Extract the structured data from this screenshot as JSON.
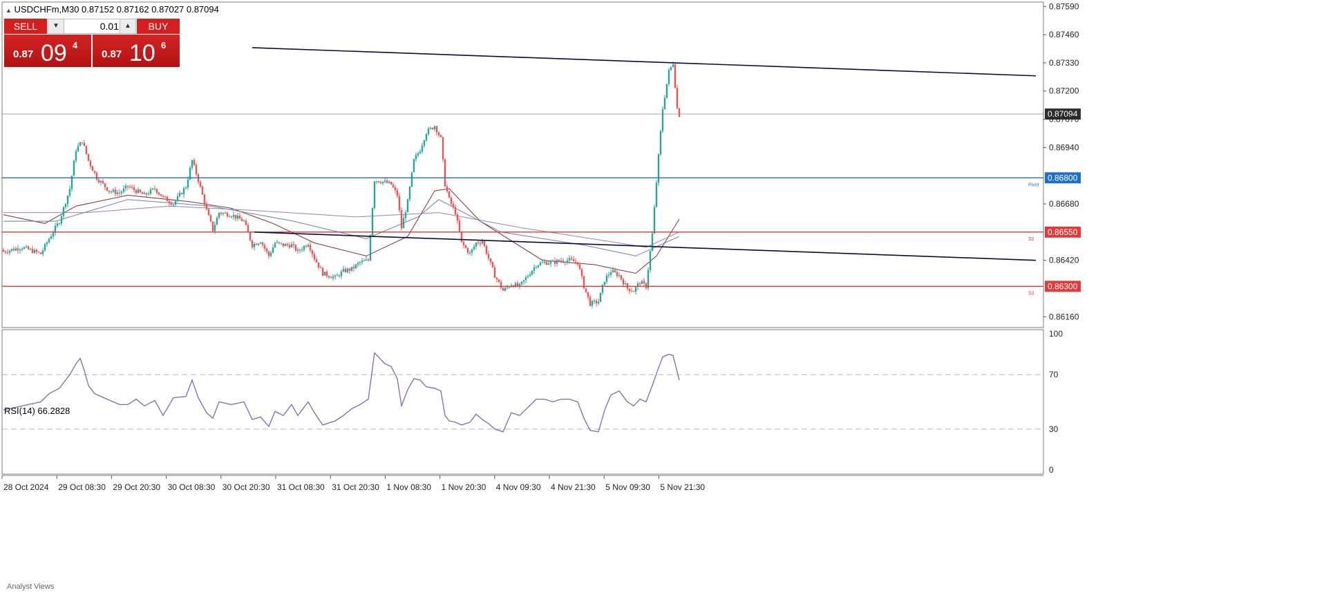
{
  "header": {
    "symbol_info": "USDCHFm,M30  0.87152 0.87162 0.87027 0.87094",
    "collapse_icon": "triangle-up-icon"
  },
  "trade_panel": {
    "sell_label": "SELL",
    "buy_label": "BUY",
    "lot_value": "0.01",
    "sell_prefix": "0.87",
    "sell_big": "09",
    "sell_sup": "4",
    "buy_prefix": "0.87",
    "buy_big": "10",
    "buy_sup": "6",
    "button_color": "#d31f1f"
  },
  "footer": {
    "tab_label": "Analyst Views"
  },
  "colors": {
    "bull_candle": "#26a69a",
    "bear_candle": "#ef5350",
    "trendline": "#0b0b3b",
    "pivot_line": "#1e6fc9",
    "support_line": "#e03a3a",
    "current_price_line": "#8a8a8a",
    "rsi_line": "#7b68b8",
    "ma_fast": "#8b2c2c",
    "ma_mid": "#6a7fa8",
    "ma_slow": "#9b7fb6"
  },
  "chart_data": [
    {
      "type": "candlestick",
      "title": "USDCHFm,M30",
      "ohlc_last": {
        "open": 0.87152,
        "high": 0.87162,
        "low": 0.87027,
        "close": 0.87094
      },
      "ylim": [
        0.8611,
        0.8761
      ],
      "y_ticks": [
        "0.87590",
        "0.87460",
        "0.87330",
        "0.87200",
        "0.87070",
        "0.86940",
        "0.86680",
        "0.86420",
        "0.86160"
      ],
      "x_ticks": [
        "28 Oct 2024",
        "29 Oct 08:30",
        "29 Oct 20:30",
        "30 Oct 08:30",
        "30 Oct 20:30",
        "31 Oct 08:30",
        "31 Oct 20:30",
        "1 Nov 08:30",
        "1 Nov 20:30",
        "4 Nov 09:30",
        "4 Nov 21:30",
        "5 Nov 09:30",
        "5 Nov 21:30"
      ],
      "series": [
        {
          "close_path": [
            [
              0,
              0.8646
            ],
            [
              9,
              0.8648
            ],
            [
              18,
              0.8645
            ],
            [
              22,
              0.8652
            ],
            [
              27,
              0.866
            ],
            [
              32,
              0.8675
            ],
            [
              35,
              0.8693
            ],
            [
              38,
              0.8697
            ],
            [
              41,
              0.8688
            ],
            [
              45,
              0.868
            ],
            [
              51,
              0.8674
            ],
            [
              56,
              0.8673
            ],
            [
              60,
              0.8676
            ],
            [
              64,
              0.8674
            ],
            [
              68,
              0.8672
            ],
            [
              73,
              0.8675
            ],
            [
              77,
              0.8671
            ],
            [
              82,
              0.8668
            ],
            [
              88,
              0.8676
            ],
            [
              91,
              0.8688
            ],
            [
              94,
              0.8679
            ],
            [
              98,
              0.8665
            ],
            [
              101,
              0.8656
            ],
            [
              104,
              0.8664
            ],
            [
              110,
              0.8663
            ],
            [
              116,
              0.866
            ],
            [
              120,
              0.8649
            ],
            [
              124,
              0.8651
            ],
            [
              128,
              0.8644
            ],
            [
              131,
              0.865
            ],
            [
              135,
              0.8649
            ],
            [
              139,
              0.8649
            ],
            [
              142,
              0.8646
            ],
            [
              147,
              0.865
            ],
            [
              150,
              0.8643
            ],
            [
              154,
              0.8636
            ],
            [
              160,
              0.8634
            ],
            [
              164,
              0.8637
            ],
            [
              168,
              0.8638
            ],
            [
              172,
              0.8641
            ],
            [
              176,
              0.8642
            ],
            [
              179,
              0.8679
            ],
            [
              184,
              0.8678
            ],
            [
              187,
              0.8677
            ],
            [
              190,
              0.8672
            ],
            [
              192,
              0.8657
            ],
            [
              195,
              0.8669
            ],
            [
              198,
              0.8688
            ],
            [
              201,
              0.8693
            ],
            [
              204,
              0.8701
            ],
            [
              208,
              0.8704
            ],
            [
              211,
              0.8698
            ],
            [
              213,
              0.8677
            ],
            [
              215,
              0.867
            ],
            [
              218,
              0.8664
            ],
            [
              221,
              0.865
            ],
            [
              225,
              0.8645
            ],
            [
              228,
              0.865
            ],
            [
              231,
              0.8651
            ],
            [
              234,
              0.8643
            ],
            [
              237,
              0.8635
            ],
            [
              241,
              0.8628
            ],
            [
              245,
              0.8631
            ],
            [
              249,
              0.863
            ],
            [
              253,
              0.8635
            ],
            [
              257,
              0.864
            ],
            [
              261,
              0.8641
            ],
            [
              265,
              0.8641
            ],
            [
              269,
              0.8642
            ],
            [
              273,
              0.8642
            ],
            [
              277,
              0.8641
            ],
            [
              280,
              0.863
            ],
            [
              283,
              0.8622
            ],
            [
              287,
              0.8623
            ],
            [
              290,
              0.8633
            ],
            [
              293,
              0.8637
            ],
            [
              297,
              0.8635
            ],
            [
              301,
              0.8629
            ],
            [
              304,
              0.8628
            ],
            [
              307,
              0.8632
            ],
            [
              310,
              0.863
            ],
            [
              313,
              0.8654
            ],
            [
              316,
              0.869
            ],
            [
              318,
              0.8712
            ],
            [
              321,
              0.8729
            ],
            [
              323,
              0.8733
            ],
            [
              325,
              0.8712
            ],
            [
              326,
              0.8709
            ]
          ]
        }
      ],
      "moving_averages": [
        {
          "key": "ma_fast",
          "points": [
            [
              0,
              0.8663
            ],
            [
              20,
              0.8659
            ],
            [
              35,
              0.8667
            ],
            [
              60,
              0.8672
            ],
            [
              90,
              0.8669
            ],
            [
              110,
              0.8666
            ],
            [
              130,
              0.8659
            ],
            [
              150,
              0.865
            ],
            [
              175,
              0.8644
            ],
            [
              195,
              0.8653
            ],
            [
              208,
              0.8674
            ],
            [
              215,
              0.8675
            ],
            [
              230,
              0.866
            ],
            [
              260,
              0.8642
            ],
            [
              285,
              0.864
            ],
            [
              305,
              0.8636
            ],
            [
              315,
              0.8644
            ],
            [
              326,
              0.8661
            ]
          ]
        },
        {
          "key": "ma_mid",
          "points": [
            [
              0,
              0.866
            ],
            [
              25,
              0.866
            ],
            [
              60,
              0.867
            ],
            [
              100,
              0.8667
            ],
            [
              140,
              0.866
            ],
            [
              175,
              0.8652
            ],
            [
              200,
              0.8662
            ],
            [
              210,
              0.867
            ],
            [
              240,
              0.8655
            ],
            [
              280,
              0.8649
            ],
            [
              305,
              0.8644
            ],
            [
              326,
              0.8653
            ]
          ]
        },
        {
          "key": "ma_slow",
          "points": [
            [
              0,
              0.8664
            ],
            [
              40,
              0.8664
            ],
            [
              80,
              0.8667
            ],
            [
              120,
              0.8665
            ],
            [
              170,
              0.8662
            ],
            [
              210,
              0.8664
            ],
            [
              250,
              0.8657
            ],
            [
              290,
              0.8651
            ],
            [
              310,
              0.8648
            ],
            [
              326,
              0.8655
            ]
          ]
        }
      ],
      "horizontal_lines": [
        {
          "key": "pivot_line",
          "price": 0.868,
          "label": "0.86800",
          "tag": "Pivot"
        },
        {
          "key": "support_line",
          "price": 0.8655,
          "label": "0.86550",
          "tag": "S2"
        },
        {
          "key": "support_line",
          "price": 0.863,
          "label": "0.86300",
          "tag": "S3"
        },
        {
          "key": "current_price_line",
          "price": 0.87094,
          "label": "0.87094",
          "tag": ""
        }
      ],
      "trendlines": [
        {
          "from": [
            120,
            0.874
          ],
          "to": [
            498,
            0.8727
          ]
        },
        {
          "from": [
            121,
            0.8655
          ],
          "to": [
            498,
            0.8642
          ]
        }
      ]
    },
    {
      "type": "line",
      "title": "RSI(14) 66.2828",
      "ylim": [
        0,
        100
      ],
      "y_ticks": [
        "100",
        "70",
        "30",
        "0"
      ],
      "levels": [
        70,
        30
      ],
      "series": [
        {
          "name": "RSI(14)",
          "points": [
            [
              0,
              44
            ],
            [
              9,
              47
            ],
            [
              18,
              50
            ],
            [
              22,
              56
            ],
            [
              27,
              60
            ],
            [
              32,
              70
            ],
            [
              35,
              78
            ],
            [
              37,
              82
            ],
            [
              39,
              73
            ],
            [
              41,
              62
            ],
            [
              44,
              56
            ],
            [
              50,
              52
            ],
            [
              56,
              48
            ],
            [
              60,
              48
            ],
            [
              64,
              52
            ],
            [
              68,
              47
            ],
            [
              73,
              51
            ],
            [
              77,
              40
            ],
            [
              82,
              53
            ],
            [
              88,
              54
            ],
            [
              91,
              66
            ],
            [
              94,
              53
            ],
            [
              98,
              42
            ],
            [
              101,
              38
            ],
            [
              104,
              50
            ],
            [
              110,
              48
            ],
            [
              116,
              50
            ],
            [
              120,
              37
            ],
            [
              124,
              39
            ],
            [
              128,
              32
            ],
            [
              131,
              43
            ],
            [
              135,
              40
            ],
            [
              139,
              48
            ],
            [
              142,
              40
            ],
            [
              147,
              50
            ],
            [
              150,
              42
            ],
            [
              154,
              33
            ],
            [
              160,
              36
            ],
            [
              164,
              40
            ],
            [
              168,
              45
            ],
            [
              172,
              48
            ],
            [
              176,
              52
            ],
            [
              179,
              86
            ],
            [
              184,
              78
            ],
            [
              187,
              76
            ],
            [
              190,
              67
            ],
            [
              192,
              47
            ],
            [
              195,
              59
            ],
            [
              198,
              67
            ],
            [
              201,
              66
            ],
            [
              204,
              61
            ],
            [
              208,
              60
            ],
            [
              211,
              58
            ],
            [
              213,
              40
            ],
            [
              215,
              36
            ],
            [
              218,
              35
            ],
            [
              221,
              33
            ],
            [
              225,
              35
            ],
            [
              228,
              41
            ],
            [
              231,
              37
            ],
            [
              234,
              34
            ],
            [
              237,
              30
            ],
            [
              241,
              28
            ],
            [
              245,
              42
            ],
            [
              249,
              40
            ],
            [
              253,
              46
            ],
            [
              257,
              52
            ],
            [
              261,
              52
            ],
            [
              265,
              50
            ],
            [
              269,
              52
            ],
            [
              273,
              52
            ],
            [
              277,
              50
            ],
            [
              280,
              38
            ],
            [
              283,
              29
            ],
            [
              287,
              28
            ],
            [
              290,
              44
            ],
            [
              293,
              55
            ],
            [
              297,
              58
            ],
            [
              301,
              50
            ],
            [
              304,
              47
            ],
            [
              307,
              52
            ],
            [
              310,
              50
            ],
            [
              313,
              62
            ],
            [
              316,
              75
            ],
            [
              318,
              83
            ],
            [
              321,
              85
            ],
            [
              323,
              84
            ],
            [
              325,
              72
            ],
            [
              326,
              66
            ]
          ]
        }
      ]
    }
  ]
}
